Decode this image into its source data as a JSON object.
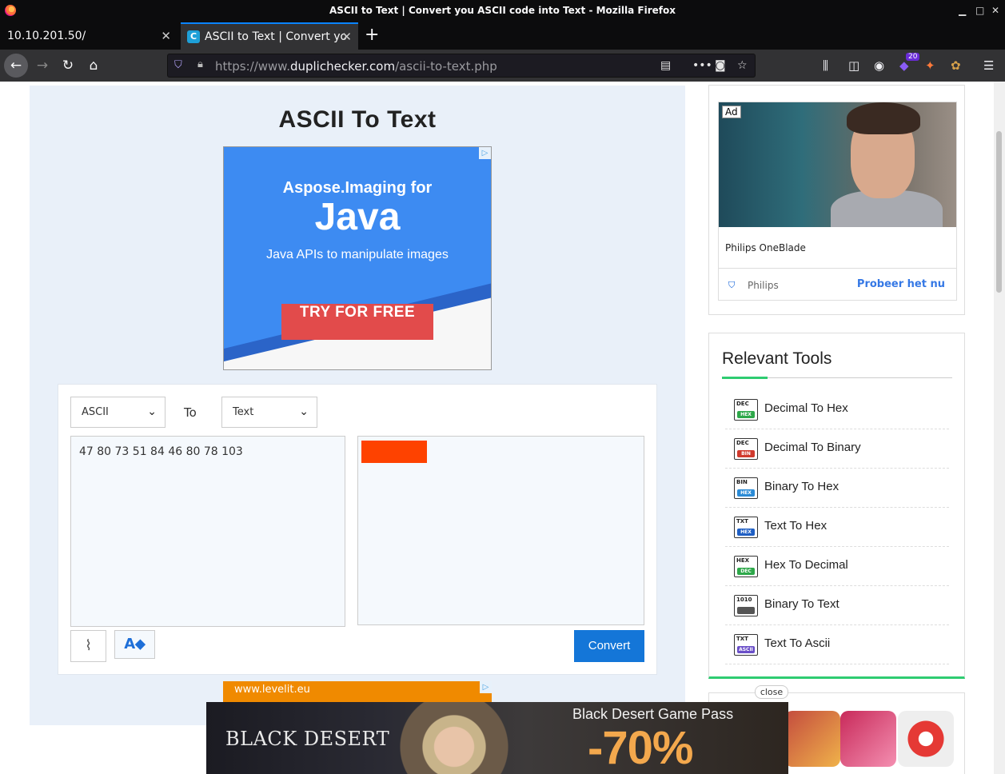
{
  "window": {
    "title": "ASCII to Text | Convert you ASCII code into Text - Mozilla Firefox"
  },
  "tabs": [
    {
      "label": "10.10.201.50/",
      "active": false
    },
    {
      "label": "ASCII to Text | Convert yo",
      "active": true
    }
  ],
  "urlbar": {
    "prefix": "https://www.",
    "domain": "duplichecker.com",
    "path": "/ascii-to-text.php"
  },
  "toolbar": {
    "extension_badge": "20"
  },
  "page": {
    "title": "ASCII To Text",
    "ad_top": {
      "line1": "Aspose.Imaging for",
      "line2": "Java",
      "line3": "Java APIs to manipulate images",
      "cta": "TRY FOR FREE"
    },
    "converter": {
      "from_value": "ASCII",
      "to_label": "To",
      "to_value": "Text",
      "input_text": "47 80 73 51 84 46 80 78 103",
      "convert_label": "Convert"
    },
    "ad_strip_text": "www.levelit.eu"
  },
  "sidebar": {
    "ad": {
      "ad_label": "Ad",
      "product": "Philips OneBlade",
      "advertiser": "Philips",
      "cta": "Probeer het nu"
    },
    "relevant_tools": {
      "heading": "Relevant Tools",
      "items": [
        {
          "label": "Decimal To Hex",
          "icon_top": "DEC",
          "icon_bot": "HEX",
          "icon_color": "#2ea84a"
        },
        {
          "label": "Decimal To Binary",
          "icon_top": "DEC",
          "icon_bot": "BIN",
          "icon_color": "#d03a2e"
        },
        {
          "label": "Binary To Hex",
          "icon_top": "BIN",
          "icon_bot": "HEX",
          "icon_color": "#2b8bd6"
        },
        {
          "label": "Text To Hex",
          "icon_top": "TXT",
          "icon_bot": "HEX",
          "icon_color": "#1f5fc4"
        },
        {
          "label": "Hex To Decimal",
          "icon_top": "HEX",
          "icon_bot": "DEC",
          "icon_color": "#2ea84a"
        },
        {
          "label": "Binary To Text",
          "icon_top": "1010",
          "icon_bot": "",
          "icon_color": "#555555"
        },
        {
          "label": "Text To Ascii",
          "icon_top": "TXT",
          "icon_bot": "ASCII",
          "icon_color": "#6a4fc8"
        }
      ]
    },
    "close_label": "close"
  },
  "bottom_ad": {
    "logo": "BLACK DESERT",
    "headline": "Black Desert Game Pass",
    "discount": "-70%"
  }
}
